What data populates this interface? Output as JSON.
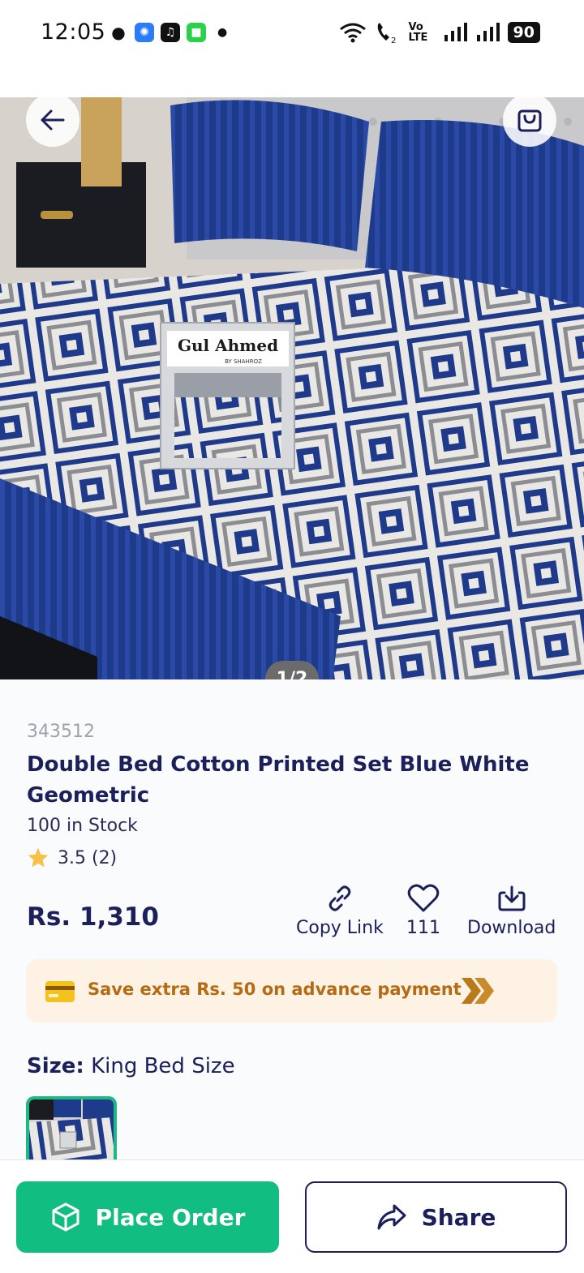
{
  "status_bar": {
    "time": "12:05",
    "battery": "90",
    "network_label": "Vo LTE"
  },
  "hero": {
    "pager": "1/2",
    "brand_on_box": "Gul Ahmed",
    "brand_sub": "BY SHAHROZ"
  },
  "product": {
    "sku": "343512",
    "title": "Double Bed Cotton Printed Set Blue White Geometric",
    "stock": "100 in Stock",
    "rating": "3.5 (2)",
    "rating_value": 3.5,
    "price": "Rs. 1,310"
  },
  "actions": {
    "copy_link": "Copy Link",
    "likes": "111",
    "download": "Download"
  },
  "promo": {
    "text": "Save extra Rs. 50 on advance payment"
  },
  "size": {
    "label": "Size:",
    "value": "King Bed Size"
  },
  "bottom": {
    "place_order": "Place Order",
    "share": "Share"
  },
  "colors": {
    "primary_green": "#12bd82",
    "navy": "#1b1f5a",
    "promo_bg": "#fdf2e3",
    "promo_text": "#b56b12"
  }
}
